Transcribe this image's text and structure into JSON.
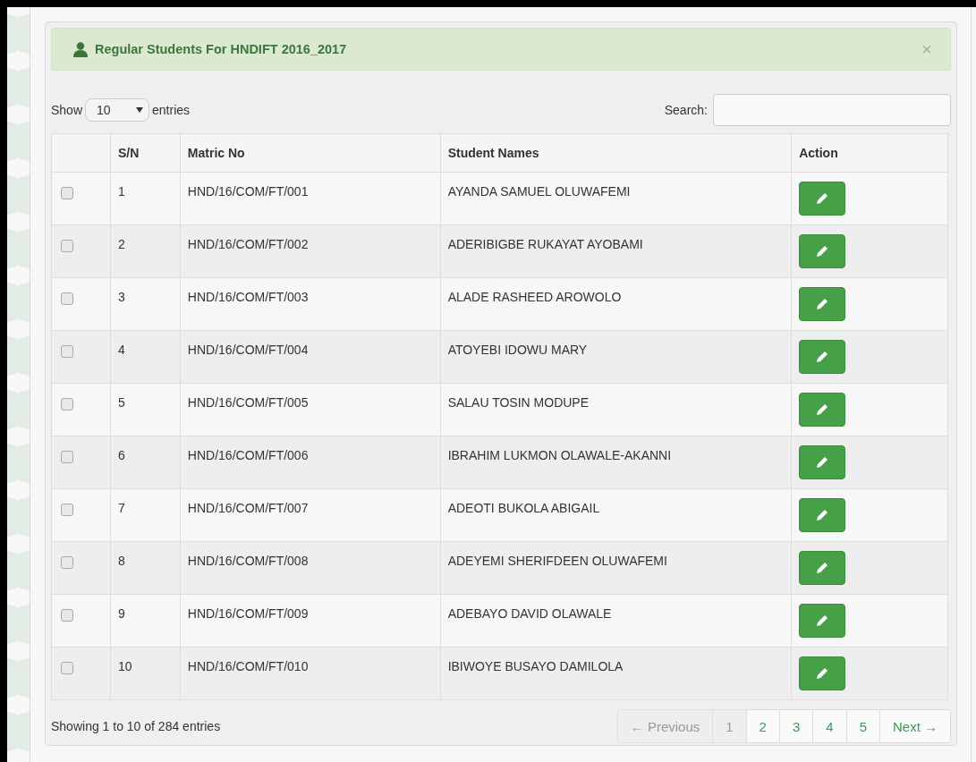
{
  "alert": {
    "title": "Regular Students For HNDIFT 2016_2017",
    "close": "×"
  },
  "length_control": {
    "prefix": "Show",
    "value": "10",
    "suffix": "entries"
  },
  "search": {
    "label": "Search:"
  },
  "table": {
    "columns": [
      "S/N",
      "Matric No",
      "Student Names",
      "Action"
    ],
    "rows": [
      {
        "checked": false,
        "sn": "1",
        "matric": "HND/16/COM/FT/001",
        "name": "AYANDA SAMUEL OLUWAFEMI"
      },
      {
        "checked": false,
        "sn": "2",
        "matric": "HND/16/COM/FT/002",
        "name": "ADERIBIGBE RUKAYAT AYOBAMI"
      },
      {
        "checked": false,
        "sn": "3",
        "matric": "HND/16/COM/FT/003",
        "name": "ALADE RASHEED AROWOLO"
      },
      {
        "checked": false,
        "sn": "4",
        "matric": "HND/16/COM/FT/004",
        "name": "ATOYEBI IDOWU MARY"
      },
      {
        "checked": false,
        "sn": "5",
        "matric": "HND/16/COM/FT/005",
        "name": "SALAU TOSIN MODUPE"
      },
      {
        "checked": false,
        "sn": "6",
        "matric": "HND/16/COM/FT/006",
        "name": "IBRAHIM LUKMON OLAWALE-AKANNI"
      },
      {
        "checked": false,
        "sn": "7",
        "matric": "HND/16/COM/FT/007",
        "name": "ADEOTI BUKOLA ABIGAIL"
      },
      {
        "checked": false,
        "sn": "8",
        "matric": "HND/16/COM/FT/008",
        "name": "ADEYEMI SHERIFDEEN OLUWAFEMI"
      },
      {
        "checked": false,
        "sn": "9",
        "matric": "HND/16/COM/FT/009",
        "name": "ADEBAYO DAVID OLAWALE"
      },
      {
        "checked": false,
        "sn": "10",
        "matric": "HND/16/COM/FT/010",
        "name": "IBIWOYE BUSAYO DAMILOLA"
      }
    ]
  },
  "info": "Showing 1 to 10 of 284 entries",
  "pagination": {
    "previous": {
      "label": "← Previous",
      "disabled": true
    },
    "pages": [
      {
        "label": "1",
        "selected": true
      },
      {
        "label": "2",
        "selected": false
      },
      {
        "label": "3",
        "selected": false
      },
      {
        "label": "4",
        "selected": false
      },
      {
        "label": "5",
        "selected": false
      }
    ],
    "next": {
      "label": "Next →",
      "disabled": false
    }
  }
}
